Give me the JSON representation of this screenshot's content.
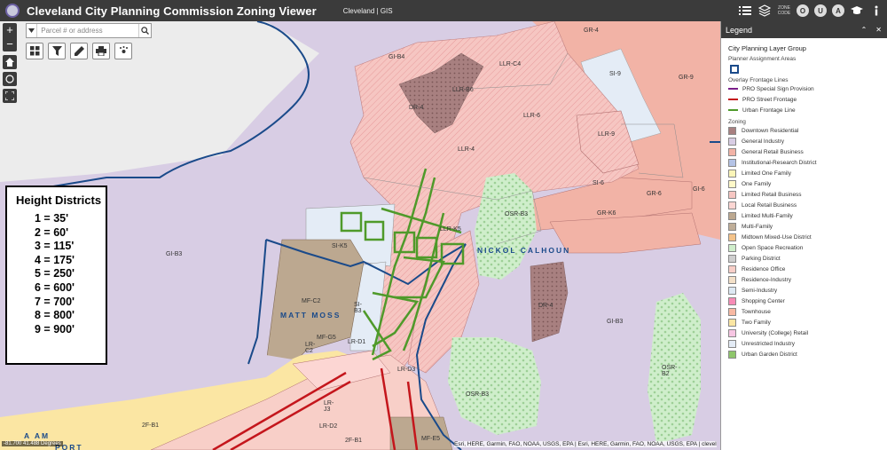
{
  "header": {
    "title": "Cleveland City Planning Commission Zoning Viewer",
    "subtitle": "Cleveland | GIS",
    "zone_code_label": "ZONE CODE",
    "buttons": [
      "O",
      "U",
      "A"
    ]
  },
  "search": {
    "placeholder": "Parcel # or address"
  },
  "map_labels": [
    {
      "text": "GI-B4"
    },
    {
      "text": "LLR-C4"
    },
    {
      "text": "GR-4"
    },
    {
      "text": "SI-9"
    },
    {
      "text": "GR-9"
    },
    {
      "text": "LLR-B6"
    },
    {
      "text": "DR-4"
    },
    {
      "text": "LLR-6"
    },
    {
      "text": "LLR-9"
    },
    {
      "text": "LLR-4"
    },
    {
      "text": "SI-6"
    },
    {
      "text": "GR-6"
    },
    {
      "text": "GI-6"
    },
    {
      "text": "OSR-B3"
    },
    {
      "text": "GR-K6"
    },
    {
      "text": "LLR-K5"
    },
    {
      "text": "SI-K5"
    },
    {
      "text": "GI-B3"
    },
    {
      "text": "MF-C2"
    },
    {
      "text": "SI-B3"
    },
    {
      "text": "DR-4"
    },
    {
      "text": "GI-B3"
    },
    {
      "text": "MF-G5"
    },
    {
      "text": "LR-C2"
    },
    {
      "text": "LR-D1"
    },
    {
      "text": "LR-D3"
    },
    {
      "text": "OSR-B2"
    },
    {
      "text": "OSR-B3"
    },
    {
      "text": "LR-J3"
    },
    {
      "text": "LR-D2"
    },
    {
      "text": "2F-B1"
    },
    {
      "text": "2F-B1"
    },
    {
      "text": "MF-E5"
    }
  ],
  "street_labels": [
    "NICKOL CALHOUN",
    "MATT MOSS",
    "A  AM",
    "PORT"
  ],
  "height_districts": {
    "title": "Height Districts",
    "rows": [
      "1 = 35'",
      "2 = 60'",
      "3 = 115'",
      "4 = 175'",
      "5 = 250'",
      "6 = 600'",
      "7 = 700'",
      "8 = 800'",
      "9 = 900'"
    ]
  },
  "attribution": "Esri, HERE, Garmin, FAO, NOAA, USGS, EPA | Esri, HERE, Garmin, FAO, NOAA, USGS, EPA | clevel",
  "coords": "-81.700 41.488 Degrees",
  "legend": {
    "title": "Legend",
    "group": "City Planning Layer Group",
    "planner_label": "Planner Assignment Areas",
    "overlay_label": "Overlay Frontage Lines",
    "overlay_items": [
      {
        "label": "PRO Special Sign Provision",
        "color": "#7a1f8a"
      },
      {
        "label": "PRO Street Frontage",
        "color": "#c4161c"
      },
      {
        "label": "Urban Frontage Line",
        "color": "#4f9a2a"
      }
    ],
    "zoning_label": "Zoning",
    "zoning_items": [
      {
        "label": "Downtown Residential",
        "color": "#a88080"
      },
      {
        "label": "General Industry",
        "color": "#d8cde4"
      },
      {
        "label": "General Retail Business",
        "color": "#f2b3a6"
      },
      {
        "label": "Institutional-Research District",
        "color": "#b4c3e6"
      },
      {
        "label": "Limited One Family",
        "color": "#fbf5b8"
      },
      {
        "label": "One Family",
        "color": "#fff9c9"
      },
      {
        "label": "Limited Retail Business",
        "color": "#f6c6c2"
      },
      {
        "label": "Local Retail Business",
        "color": "#fcd6d3"
      },
      {
        "label": "Limited Multi-Family",
        "color": "#bca890"
      },
      {
        "label": "Multi-Family",
        "color": "#bfae98"
      },
      {
        "label": "Midtown Mixed-Use District",
        "color": "#f4c38a"
      },
      {
        "label": "Open Space Recreation",
        "color": "#cfeecb"
      },
      {
        "label": "Parking District",
        "color": "#cfcfcf"
      },
      {
        "label": "Residence Office",
        "color": "#f8cfc8"
      },
      {
        "label": "Residence-Industry",
        "color": "#f3e0c8"
      },
      {
        "label": "Semi-Industry",
        "color": "#dde9f3"
      },
      {
        "label": "Shopping Center",
        "color": "#f78cb6"
      },
      {
        "label": "Townhouse",
        "color": "#f8b9a3"
      },
      {
        "label": "Two Family",
        "color": "#fbe6a3"
      },
      {
        "label": "University (College) Retail",
        "color": "#f7c6e3"
      },
      {
        "label": "Unrestricted Industry",
        "color": "#e4ecf6"
      },
      {
        "label": "Urban Garden District",
        "color": "#8fc66b"
      }
    ]
  }
}
